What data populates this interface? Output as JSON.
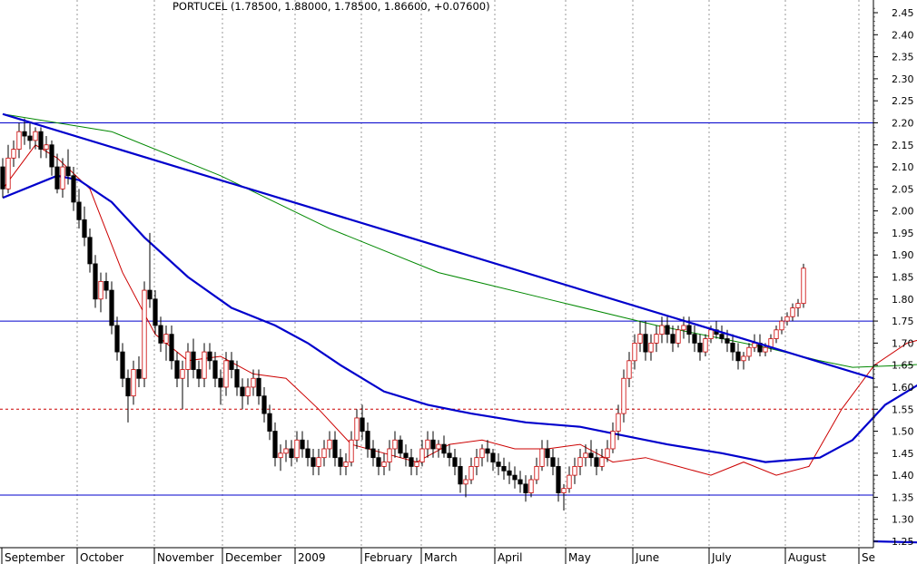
{
  "chart_data": {
    "type": "candlestick",
    "title": "PORTUCEL (1.78500, 1.88000, 1.78500, 1.86600, +0.07600)",
    "y_axis": {
      "position": "right",
      "ylim": [
        1.22,
        2.48
      ],
      "ticks": [
        "2.45",
        "2.40",
        "2.35",
        "2.30",
        "2.25",
        "2.20",
        "2.15",
        "2.10",
        "2.05",
        "2.00",
        "1.95",
        "1.90",
        "1.85",
        "1.80",
        "1.75",
        "1.70",
        "1.65",
        "1.60",
        "1.55",
        "1.50",
        "1.45",
        "1.40",
        "1.35",
        "1.30",
        "1.25"
      ]
    },
    "x_axis": {
      "labels": [
        "September",
        "October",
        "November",
        "December",
        "2009",
        "February",
        "March",
        "April",
        "May",
        "June",
        "July",
        "August",
        "Se"
      ]
    },
    "grid": "vertical dotted at month starts",
    "horizontal_levels": [
      {
        "value": 2.2,
        "style": "solid",
        "color": "#0000cc"
      },
      {
        "value": 1.75,
        "style": "solid",
        "color": "#0000cc"
      },
      {
        "value": 1.55,
        "style": "dotted",
        "color": "#cc0000"
      },
      {
        "value": 1.355,
        "style": "solid",
        "color": "#0000cc"
      }
    ],
    "trendlines": [
      {
        "from": [
          0,
          2.22
        ],
        "to": [
          244,
          1.62
        ],
        "color": "#0000cc"
      },
      {
        "from": [
          192,
          1.24
        ],
        "to": [
          244,
          1.25
        ],
        "color": "#0000cc"
      }
    ],
    "moving_averages": [
      {
        "color": "#cc0000",
        "points": [
          [
            0,
            2.05
          ],
          [
            6,
            2.15
          ],
          [
            10,
            2.12
          ],
          [
            16,
            2.05
          ],
          [
            22,
            1.86
          ],
          [
            28,
            1.72
          ],
          [
            34,
            1.66
          ],
          [
            40,
            1.67
          ],
          [
            46,
            1.63
          ],
          [
            52,
            1.62
          ],
          [
            58,
            1.55
          ],
          [
            64,
            1.47
          ],
          [
            70,
            1.45
          ],
          [
            76,
            1.43
          ],
          [
            82,
            1.47
          ],
          [
            88,
            1.48
          ],
          [
            94,
            1.46
          ],
          [
            100,
            1.46
          ],
          [
            106,
            1.47
          ],
          [
            112,
            1.43
          ],
          [
            118,
            1.44
          ],
          [
            124,
            1.42
          ],
          [
            130,
            1.4
          ],
          [
            136,
            1.43
          ],
          [
            142,
            1.4
          ],
          [
            148,
            1.42
          ],
          [
            154,
            1.55
          ],
          [
            160,
            1.65
          ],
          [
            166,
            1.7
          ],
          [
            172,
            1.72
          ],
          [
            178,
            1.73
          ],
          [
            184,
            1.74
          ],
          [
            190,
            1.73
          ],
          [
            196,
            1.72
          ],
          [
            202,
            1.7
          ],
          [
            208,
            1.68
          ],
          [
            214,
            1.67
          ],
          [
            220,
            1.69
          ],
          [
            226,
            1.74
          ],
          [
            232,
            1.78
          ]
        ]
      },
      {
        "color": "#0000cc",
        "points": [
          [
            0,
            2.03
          ],
          [
            10,
            2.08
          ],
          [
            14,
            2.07
          ],
          [
            20,
            2.02
          ],
          [
            26,
            1.94
          ],
          [
            34,
            1.85
          ],
          [
            42,
            1.78
          ],
          [
            50,
            1.74
          ],
          [
            56,
            1.7
          ],
          [
            62,
            1.65
          ],
          [
            70,
            1.59
          ],
          [
            78,
            1.56
          ],
          [
            86,
            1.54
          ],
          [
            96,
            1.52
          ],
          [
            106,
            1.51
          ],
          [
            114,
            1.49
          ],
          [
            122,
            1.47
          ],
          [
            132,
            1.45
          ],
          [
            140,
            1.43
          ],
          [
            150,
            1.44
          ],
          [
            156,
            1.48
          ],
          [
            162,
            1.56
          ],
          [
            170,
            1.62
          ],
          [
            178,
            1.64
          ],
          [
            186,
            1.66
          ],
          [
            194,
            1.67
          ],
          [
            202,
            1.68
          ],
          [
            210,
            1.69
          ],
          [
            218,
            1.7
          ],
          [
            226,
            1.71
          ],
          [
            232,
            1.725
          ]
        ]
      },
      {
        "color": "#008800",
        "points": [
          [
            0,
            2.22
          ],
          [
            20,
            2.18
          ],
          [
            40,
            2.08
          ],
          [
            60,
            1.96
          ],
          [
            80,
            1.86
          ],
          [
            100,
            1.8
          ],
          [
            120,
            1.74
          ],
          [
            140,
            1.69
          ],
          [
            150,
            1.66
          ],
          [
            156,
            1.645
          ],
          [
            166,
            1.65
          ],
          [
            180,
            1.66
          ],
          [
            194,
            1.665
          ],
          [
            210,
            1.67
          ],
          [
            232,
            1.685
          ]
        ]
      }
    ],
    "candles": [
      [
        0,
        2.1,
        2.12,
        2.03,
        2.05
      ],
      [
        1,
        2.05,
        2.15,
        2.04,
        2.12
      ],
      [
        2,
        2.12,
        2.16,
        2.1,
        2.14
      ],
      [
        3,
        2.14,
        2.2,
        2.12,
        2.18
      ],
      [
        4,
        2.18,
        2.21,
        2.15,
        2.17
      ],
      [
        5,
        2.17,
        2.2,
        2.14,
        2.16
      ],
      [
        6,
        2.16,
        2.19,
        2.14,
        2.18
      ],
      [
        7,
        2.18,
        2.19,
        2.12,
        2.14
      ],
      [
        8,
        2.14,
        2.17,
        2.12,
        2.15
      ],
      [
        9,
        2.15,
        2.16,
        2.08,
        2.1
      ],
      [
        10,
        2.1,
        2.13,
        2.04,
        2.05
      ],
      [
        11,
        2.05,
        2.12,
        2.03,
        2.1
      ],
      [
        12,
        2.1,
        2.14,
        2.06,
        2.08
      ],
      [
        13,
        2.08,
        2.1,
        2.0,
        2.02
      ],
      [
        14,
        2.02,
        2.05,
        1.96,
        1.98
      ],
      [
        15,
        1.98,
        2.01,
        1.92,
        1.94
      ],
      [
        16,
        1.94,
        1.96,
        1.86,
        1.88
      ],
      [
        17,
        1.88,
        1.9,
        1.78,
        1.8
      ],
      [
        18,
        1.8,
        1.86,
        1.77,
        1.84
      ],
      [
        19,
        1.84,
        1.86,
        1.8,
        1.82
      ],
      [
        20,
        1.82,
        1.84,
        1.72,
        1.74
      ],
      [
        21,
        1.74,
        1.76,
        1.66,
        1.68
      ],
      [
        22,
        1.68,
        1.7,
        1.6,
        1.62
      ],
      [
        23,
        1.62,
        1.64,
        1.52,
        1.58
      ],
      [
        24,
        1.58,
        1.66,
        1.56,
        1.64
      ],
      [
        25,
        1.64,
        1.67,
        1.6,
        1.62
      ],
      [
        26,
        1.62,
        1.84,
        1.6,
        1.82
      ],
      [
        27,
        1.82,
        1.95,
        1.78,
        1.8
      ],
      [
        28,
        1.8,
        1.82,
        1.72,
        1.74
      ],
      [
        29,
        1.74,
        1.76,
        1.68,
        1.7
      ],
      [
        30,
        1.7,
        1.74,
        1.66,
        1.72
      ],
      [
        31,
        1.72,
        1.74,
        1.64,
        1.66
      ],
      [
        32,
        1.66,
        1.68,
        1.6,
        1.62
      ],
      [
        33,
        1.62,
        1.66,
        1.55,
        1.64
      ],
      [
        34,
        1.64,
        1.7,
        1.6,
        1.68
      ],
      [
        35,
        1.68,
        1.71,
        1.62,
        1.64
      ],
      [
        36,
        1.64,
        1.66,
        1.6,
        1.62
      ],
      [
        37,
        1.62,
        1.7,
        1.6,
        1.68
      ],
      [
        38,
        1.68,
        1.7,
        1.64,
        1.66
      ],
      [
        39,
        1.66,
        1.68,
        1.6,
        1.62
      ],
      [
        40,
        1.62,
        1.64,
        1.56,
        1.6
      ],
      [
        41,
        1.6,
        1.68,
        1.58,
        1.66
      ],
      [
        42,
        1.66,
        1.68,
        1.62,
        1.64
      ],
      [
        43,
        1.64,
        1.66,
        1.58,
        1.6
      ],
      [
        44,
        1.6,
        1.62,
        1.55,
        1.58
      ],
      [
        45,
        1.58,
        1.62,
        1.56,
        1.6
      ],
      [
        46,
        1.6,
        1.64,
        1.58,
        1.62
      ],
      [
        47,
        1.62,
        1.64,
        1.56,
        1.58
      ],
      [
        48,
        1.58,
        1.6,
        1.52,
        1.54
      ],
      [
        49,
        1.54,
        1.56,
        1.48,
        1.5
      ],
      [
        50,
        1.5,
        1.52,
        1.42,
        1.44
      ],
      [
        51,
        1.44,
        1.47,
        1.41,
        1.45
      ],
      [
        52,
        1.45,
        1.48,
        1.43,
        1.46
      ],
      [
        53,
        1.46,
        1.48,
        1.42,
        1.44
      ],
      [
        54,
        1.44,
        1.5,
        1.43,
        1.48
      ],
      [
        55,
        1.48,
        1.5,
        1.44,
        1.46
      ],
      [
        56,
        1.46,
        1.48,
        1.42,
        1.44
      ],
      [
        57,
        1.44,
        1.46,
        1.4,
        1.42
      ],
      [
        58,
        1.42,
        1.46,
        1.4,
        1.44
      ],
      [
        59,
        1.44,
        1.48,
        1.42,
        1.46
      ],
      [
        60,
        1.46,
        1.5,
        1.44,
        1.48
      ],
      [
        61,
        1.48,
        1.5,
        1.42,
        1.44
      ],
      [
        62,
        1.44,
        1.46,
        1.4,
        1.42
      ],
      [
        63,
        1.42,
        1.45,
        1.4,
        1.43
      ],
      [
        64,
        1.43,
        1.5,
        1.42,
        1.48
      ],
      [
        65,
        1.48,
        1.55,
        1.46,
        1.53
      ],
      [
        66,
        1.53,
        1.56,
        1.48,
        1.5
      ],
      [
        67,
        1.5,
        1.52,
        1.44,
        1.46
      ],
      [
        68,
        1.46,
        1.48,
        1.42,
        1.44
      ],
      [
        69,
        1.44,
        1.46,
        1.4,
        1.42
      ],
      [
        70,
        1.42,
        1.45,
        1.4,
        1.43
      ],
      [
        71,
        1.43,
        1.48,
        1.41,
        1.46
      ],
      [
        72,
        1.46,
        1.5,
        1.44,
        1.48
      ],
      [
        73,
        1.48,
        1.49,
        1.44,
        1.45
      ],
      [
        74,
        1.45,
        1.47,
        1.42,
        1.44
      ],
      [
        75,
        1.44,
        1.46,
        1.4,
        1.42
      ],
      [
        76,
        1.42,
        1.44,
        1.4,
        1.43
      ],
      [
        77,
        1.43,
        1.48,
        1.42,
        1.46
      ],
      [
        78,
        1.46,
        1.5,
        1.44,
        1.48
      ],
      [
        79,
        1.48,
        1.5,
        1.44,
        1.46
      ],
      [
        80,
        1.46,
        1.48,
        1.44,
        1.47
      ],
      [
        81,
        1.47,
        1.49,
        1.44,
        1.45
      ],
      [
        82,
        1.45,
        1.47,
        1.42,
        1.44
      ],
      [
        83,
        1.44,
        1.46,
        1.4,
        1.42
      ],
      [
        84,
        1.42,
        1.44,
        1.36,
        1.38
      ],
      [
        85,
        1.38,
        1.4,
        1.35,
        1.39
      ],
      [
        86,
        1.39,
        1.44,
        1.38,
        1.42
      ],
      [
        87,
        1.42,
        1.46,
        1.4,
        1.44
      ],
      [
        88,
        1.44,
        1.47,
        1.42,
        1.46
      ],
      [
        89,
        1.46,
        1.48,
        1.43,
        1.45
      ],
      [
        90,
        1.45,
        1.46,
        1.41,
        1.43
      ],
      [
        91,
        1.43,
        1.45,
        1.4,
        1.42
      ],
      [
        92,
        1.42,
        1.44,
        1.39,
        1.41
      ],
      [
        93,
        1.41,
        1.43,
        1.38,
        1.4
      ],
      [
        94,
        1.4,
        1.42,
        1.37,
        1.39
      ],
      [
        95,
        1.39,
        1.41,
        1.36,
        1.38
      ],
      [
        96,
        1.38,
        1.4,
        1.34,
        1.36
      ],
      [
        97,
        1.36,
        1.4,
        1.35,
        1.39
      ],
      [
        98,
        1.39,
        1.44,
        1.38,
        1.42
      ],
      [
        99,
        1.42,
        1.48,
        1.41,
        1.46
      ],
      [
        100,
        1.46,
        1.48,
        1.42,
        1.44
      ],
      [
        101,
        1.44,
        1.46,
        1.4,
        1.42
      ],
      [
        102,
        1.42,
        1.44,
        1.34,
        1.36
      ],
      [
        103,
        1.36,
        1.38,
        1.32,
        1.37
      ],
      [
        104,
        1.37,
        1.42,
        1.36,
        1.4
      ],
      [
        105,
        1.4,
        1.44,
        1.38,
        1.42
      ],
      [
        106,
        1.42,
        1.46,
        1.4,
        1.44
      ],
      [
        107,
        1.44,
        1.47,
        1.42,
        1.45
      ],
      [
        108,
        1.45,
        1.48,
        1.42,
        1.44
      ],
      [
        109,
        1.44,
        1.46,
        1.4,
        1.42
      ],
      [
        110,
        1.42,
        1.46,
        1.41,
        1.44
      ],
      [
        111,
        1.44,
        1.48,
        1.43,
        1.46
      ],
      [
        112,
        1.46,
        1.52,
        1.45,
        1.5
      ],
      [
        113,
        1.5,
        1.56,
        1.48,
        1.54
      ],
      [
        114,
        1.54,
        1.64,
        1.52,
        1.62
      ],
      [
        115,
        1.62,
        1.68,
        1.6,
        1.66
      ],
      [
        116,
        1.66,
        1.72,
        1.64,
        1.7
      ],
      [
        117,
        1.7,
        1.75,
        1.68,
        1.72
      ],
      [
        118,
        1.72,
        1.75,
        1.66,
        1.68
      ],
      [
        119,
        1.68,
        1.72,
        1.66,
        1.7
      ],
      [
        120,
        1.7,
        1.74,
        1.68,
        1.72
      ],
      [
        121,
        1.72,
        1.76,
        1.7,
        1.74
      ],
      [
        122,
        1.74,
        1.76,
        1.7,
        1.72
      ],
      [
        123,
        1.72,
        1.74,
        1.68,
        1.7
      ],
      [
        124,
        1.7,
        1.74,
        1.69,
        1.73
      ],
      [
        125,
        1.73,
        1.76,
        1.71,
        1.74
      ],
      [
        126,
        1.74,
        1.76,
        1.7,
        1.72
      ],
      [
        127,
        1.72,
        1.74,
        1.68,
        1.7
      ],
      [
        128,
        1.7,
        1.72,
        1.66,
        1.68
      ],
      [
        129,
        1.68,
        1.72,
        1.67,
        1.71
      ],
      [
        130,
        1.71,
        1.74,
        1.7,
        1.73
      ],
      [
        131,
        1.73,
        1.75,
        1.71,
        1.72
      ],
      [
        132,
        1.72,
        1.74,
        1.7,
        1.71
      ],
      [
        133,
        1.71,
        1.73,
        1.68,
        1.7
      ],
      [
        134,
        1.7,
        1.72,
        1.66,
        1.68
      ],
      [
        135,
        1.68,
        1.7,
        1.64,
        1.66
      ],
      [
        136,
        1.66,
        1.68,
        1.64,
        1.67
      ],
      [
        137,
        1.67,
        1.7,
        1.66,
        1.69
      ],
      [
        138,
        1.69,
        1.72,
        1.68,
        1.7
      ],
      [
        139,
        1.7,
        1.72,
        1.67,
        1.68
      ],
      [
        140,
        1.68,
        1.7,
        1.67,
        1.69
      ],
      [
        141,
        1.69,
        1.72,
        1.68,
        1.71
      ],
      [
        142,
        1.71,
        1.74,
        1.7,
        1.73
      ],
      [
        143,
        1.73,
        1.76,
        1.72,
        1.75
      ],
      [
        144,
        1.75,
        1.77,
        1.74,
        1.76
      ],
      [
        145,
        1.76,
        1.79,
        1.75,
        1.78
      ],
      [
        146,
        1.78,
        1.8,
        1.76,
        1.79
      ],
      [
        147,
        1.79,
        1.88,
        1.78,
        1.87
      ]
    ]
  }
}
